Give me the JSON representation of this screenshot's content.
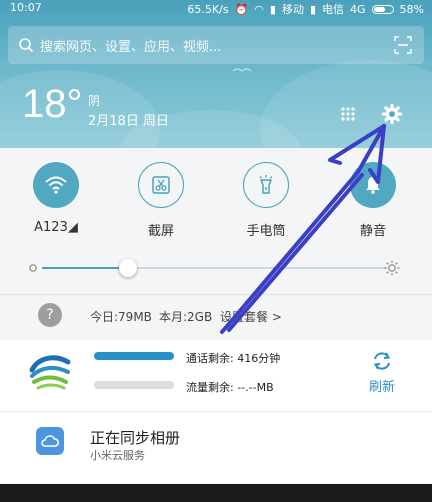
{
  "status_bar": {
    "time": "10:07",
    "speed": "65.5K/s",
    "carrier1": "移动",
    "carrier2": "电信",
    "network": "4G",
    "battery": "58%",
    "battery_level": 0.58
  },
  "search": {
    "placeholder": "搜索网页、设置、应用、视频..."
  },
  "weather": {
    "temperature": "18°",
    "condition": "阴",
    "date": "2月18日 周日"
  },
  "toggles": [
    {
      "label": "A123◢",
      "icon": "wifi-icon",
      "active": true
    },
    {
      "label": "截屏",
      "icon": "screenshot-icon",
      "active": false
    },
    {
      "label": "手电筒",
      "icon": "flashlight-icon",
      "active": false
    },
    {
      "label": "静音",
      "icon": "bell-icon",
      "active": true
    }
  ],
  "brightness": {
    "level": 0.25
  },
  "data_usage": {
    "today": "今日:79MB",
    "month": "本月:2GB",
    "link": "设置套餐 >"
  },
  "notifications": {
    "mobile": {
      "call_remaining": "通话剩余: 416分钟",
      "data_remaining": "流量剩余: --.--MB",
      "refresh_label": "刷新"
    },
    "cloud": {
      "title": "正在同步相册",
      "subtitle": "小米云服务"
    }
  },
  "colors": {
    "accent": "#4aa1bb",
    "arrow": "#3b3fc5",
    "refresh": "#2b8fc7"
  }
}
